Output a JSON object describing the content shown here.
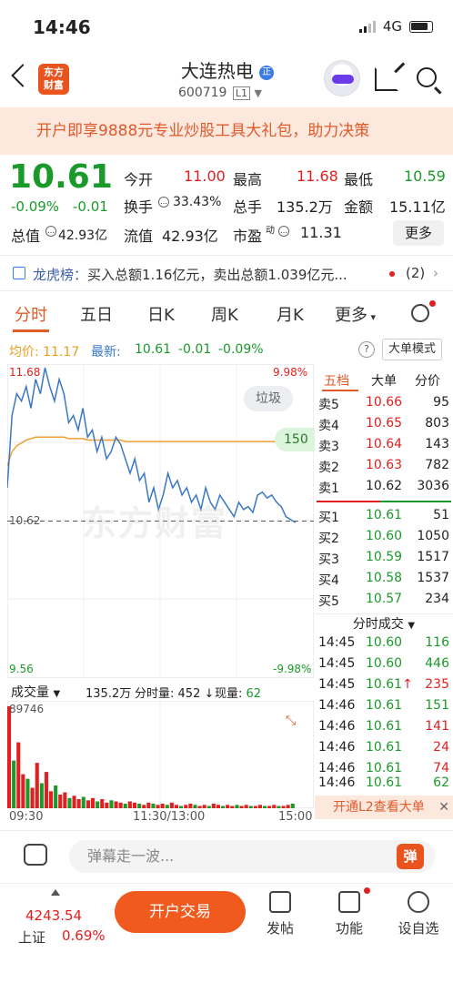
{
  "status": {
    "time": "14:46",
    "network": "4G"
  },
  "header": {
    "logo": "东方财富",
    "title": "大连热电",
    "badge": "正",
    "code": "600719",
    "level": "L1"
  },
  "banner": {
    "text": "开户即享9888元专业炒股工具大礼包，助力决策"
  },
  "quote": {
    "price": "10.61",
    "change_pct": "-0.09%",
    "change": "-0.01",
    "fields": [
      {
        "label": "今开",
        "value": "11.00",
        "color": "red"
      },
      {
        "label": "最高",
        "value": "11.68",
        "color": "red"
      },
      {
        "label": "最低",
        "value": "10.59",
        "color": "green"
      },
      {
        "label": "换手",
        "value": "33.43%",
        "color": "black"
      },
      {
        "label": "总手",
        "value": "135.2万",
        "color": "black"
      },
      {
        "label": "金额",
        "value": "15.11亿",
        "color": "black"
      },
      {
        "label": "总值",
        "value": "42.93亿",
        "color": "black"
      },
      {
        "label": "流值",
        "value": "42.93亿",
        "color": "black"
      },
      {
        "label": "市盈",
        "value": "11.31",
        "color": "black"
      }
    ],
    "pe_sup": "动",
    "more": "更多"
  },
  "dragon": {
    "label": "龙虎榜：",
    "text": "买入总额1.16亿元，卖出总额1.039亿元...",
    "count": "(2)"
  },
  "tabs": [
    "分时",
    "五日",
    "日K",
    "周K",
    "月K",
    "更多"
  ],
  "avg": {
    "avg_label": "均价:",
    "avg_value": "11.17",
    "latest_label": "最新:",
    "latest_value": "10.61",
    "latest_change": "-0.01",
    "latest_pct": "-0.09%",
    "help": "?",
    "big_order": "大单模式"
  },
  "chart_labels": {
    "high": "11.68",
    "high_pct": "9.98%",
    "mid": "10.62",
    "low": "9.56",
    "low_pct": "-9.98%",
    "trash": "垃圾",
    "counter": "150",
    "watermark": "东方财富"
  },
  "chart_data": {
    "type": "line",
    "ylim": [
      9.56,
      11.68
    ],
    "series": [
      {
        "values": [
          10.85,
          11.35,
          11.5,
          11.45,
          11.55,
          11.4,
          11.6,
          11.5,
          11.68,
          11.55,
          11.45,
          11.6,
          11.5,
          11.3,
          11.35,
          11.25,
          11.4,
          11.2,
          11.25,
          11.1,
          11.2,
          11.05,
          11.1,
          11.2,
          11.15,
          11.05,
          10.95,
          11.05,
          10.9,
          10.95,
          10.75,
          10.85,
          10.7,
          10.8,
          10.95,
          10.85,
          10.9,
          10.8,
          10.85,
          10.75,
          10.8,
          10.7,
          10.85,
          10.75,
          10.7,
          10.8,
          10.75,
          10.7,
          10.65,
          10.75,
          10.7,
          10.72,
          10.68,
          10.8,
          10.82,
          10.78,
          10.8,
          10.75,
          10.72,
          10.65,
          10.63,
          10.61
        ]
      },
      {
        "values": [
          11.0,
          11.1,
          11.14,
          11.16,
          11.18,
          11.19,
          11.2,
          11.2,
          11.2,
          11.2,
          11.2,
          11.2,
          11.2,
          11.19,
          11.19,
          11.19,
          11.19,
          11.18,
          11.18,
          11.18,
          11.18,
          11.18,
          11.18,
          11.18,
          11.18,
          11.17,
          11.17,
          11.17,
          11.17,
          11.17,
          11.17,
          11.17,
          11.17,
          11.17,
          11.17,
          11.17,
          11.17,
          11.17,
          11.17,
          11.17,
          11.17,
          11.17,
          11.17,
          11.17,
          11.17,
          11.17,
          11.17,
          11.17,
          11.17,
          11.17,
          11.17,
          11.17,
          11.17,
          11.17,
          11.17,
          11.17,
          11.17,
          11.17,
          11.17,
          11.17,
          11.17,
          11.17
        ]
      }
    ],
    "base": 10.62,
    "colors": {
      "price": "#3a78c2",
      "avg": "#f0a030"
    },
    "volume": [
      89746,
      42000,
      58000,
      30000,
      26000,
      18000,
      40000,
      22000,
      32000,
      15000,
      20000,
      12000,
      14000,
      9000,
      11000,
      8000,
      10000,
      7000,
      9000,
      6000,
      8000,
      5000,
      7000,
      6000,
      5000,
      4000,
      6000,
      5000,
      4000,
      3000,
      5000,
      4000,
      3000,
      4000,
      3000,
      5000,
      3000,
      2000,
      3000,
      4000,
      3000,
      2000,
      3000,
      2000,
      4000,
      3000,
      2000,
      3000,
      2000,
      3000,
      2000,
      3000,
      2000,
      2000,
      3000,
      2000,
      2000,
      3000,
      2000,
      2000,
      3000,
      4000
    ],
    "volume_max": 89746
  },
  "volume": {
    "label": "成交量",
    "total": "135.2万",
    "split_label": "分时量:",
    "split_value": "452",
    "arrow": "↓",
    "now_label": "现量:",
    "now_value": "62",
    "max": "89746"
  },
  "timeaxis": {
    "start": "09:30",
    "mid": "11:30/13:00",
    "end": "15:00"
  },
  "book": {
    "tabs": [
      "五档",
      "大单",
      "分价"
    ],
    "sells": [
      {
        "label": "卖5",
        "price": "10.66",
        "vol": "95"
      },
      {
        "label": "卖4",
        "price": "10.65",
        "vol": "803"
      },
      {
        "label": "卖3",
        "price": "10.64",
        "vol": "143"
      },
      {
        "label": "卖2",
        "price": "10.63",
        "vol": "782"
      },
      {
        "label": "卖1",
        "price": "10.62",
        "vol": "3036"
      }
    ],
    "buys": [
      {
        "label": "买1",
        "price": "10.61",
        "vol": "51"
      },
      {
        "label": "买2",
        "price": "10.60",
        "vol": "1050"
      },
      {
        "label": "买3",
        "price": "10.59",
        "vol": "1517"
      },
      {
        "label": "买4",
        "price": "10.58",
        "vol": "1537"
      },
      {
        "label": "买5",
        "price": "10.57",
        "vol": "234"
      }
    ],
    "trades_title": "分时成交",
    "trades": [
      {
        "time": "14:45",
        "price": "10.60",
        "vol": "116",
        "pc": "green",
        "vc": "green",
        "arrow": ""
      },
      {
        "time": "14:45",
        "price": "10.60",
        "vol": "446",
        "pc": "green",
        "vc": "green",
        "arrow": ""
      },
      {
        "time": "14:45",
        "price": "10.61",
        "vol": "235",
        "pc": "green",
        "vc": "red",
        "arrow": "↑"
      },
      {
        "time": "14:46",
        "price": "10.61",
        "vol": "151",
        "pc": "green",
        "vc": "green",
        "arrow": ""
      },
      {
        "time": "14:46",
        "price": "10.61",
        "vol": "141",
        "pc": "green",
        "vc": "red",
        "arrow": ""
      },
      {
        "time": "14:46",
        "price": "10.61",
        "vol": "24",
        "pc": "green",
        "vc": "red",
        "arrow": ""
      },
      {
        "time": "14:46",
        "price": "10.61",
        "vol": "74",
        "pc": "green",
        "vc": "red",
        "arrow": ""
      },
      {
        "time": "14:46",
        "price": "10.61",
        "vol": "62",
        "pc": "green",
        "vc": "green",
        "arrow": ""
      }
    ],
    "l2": "开通L2查看大单",
    "l2_close": "✕"
  },
  "comment": {
    "placeholder": "弹幕走一波...",
    "danmu": "弹"
  },
  "bottom": {
    "index_value": "4243.54",
    "index_name": "上证",
    "index_change": "0.69%",
    "trade": "开户交易",
    "post": "发帖",
    "function": "功能",
    "custom": "设自选"
  }
}
